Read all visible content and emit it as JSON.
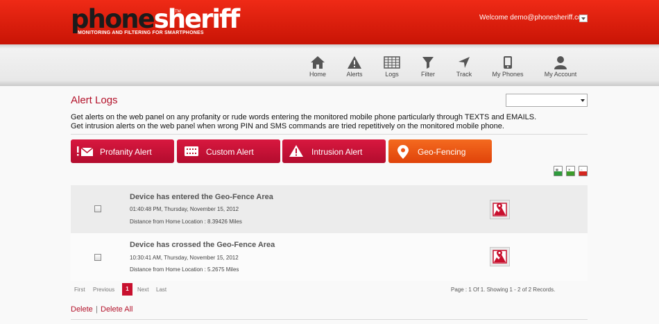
{
  "brand": {
    "part1": "phone",
    "part2": "sheriff",
    "tm": "TM",
    "tagline": "MONITORING AND FILTERING FOR SMARTPHONES"
  },
  "user": {
    "welcome": "Welcome demo@phonesheriff.com"
  },
  "nav": [
    {
      "label": "Home",
      "icon": "home-icon"
    },
    {
      "label": "Alerts",
      "icon": "alert-triangle-icon"
    },
    {
      "label": "Logs",
      "icon": "logs-grid-icon"
    },
    {
      "label": "Filter",
      "icon": "funnel-icon"
    },
    {
      "label": "Track",
      "icon": "location-arrow-icon"
    },
    {
      "label": "My Phones",
      "icon": "phone-icon"
    },
    {
      "label": "My Account",
      "icon": "user-icon"
    }
  ],
  "page": {
    "title": "Alert Logs",
    "select_value": "",
    "desc_line1": "Get alerts on the web panel on any profanity or rude words entering the monitored mobile phone particularly through TEXTS and EMAILS.",
    "desc_line2": "Get intrusion alerts on the web panel when wrong PIN and SMS commands are tried repetitively on the monitored mobile phone."
  },
  "alert_buttons": [
    {
      "label": "Profanity Alert",
      "icon": "mail-exclaim-icon",
      "active": false
    },
    {
      "label": "Custom Alert",
      "icon": "keypad-icon",
      "active": false
    },
    {
      "label": "Intrusion Alert",
      "icon": "warning-icon",
      "active": false
    },
    {
      "label": "Geo-Fencing",
      "icon": "map-pin-icon",
      "active": true
    }
  ],
  "exports": [
    {
      "name": "csv-export-icon",
      "color": "#2e9b3c"
    },
    {
      "name": "xls-export-icon",
      "color": "#3c9c2a"
    },
    {
      "name": "pdf-export-icon",
      "color": "#d4261f"
    }
  ],
  "records": [
    {
      "title": "Device has entered the Geo-Fence Area",
      "time": "01:40:48 PM, Thursday, November 15, 2012",
      "distance": "Distance from Home Location : 8.39426 Miles"
    },
    {
      "title": "Device has crossed the Geo-Fence Area",
      "time": "10:30:41 AM, Thursday, November 15, 2012",
      "distance": "Distance from Home Location : 5.2675 Miles"
    }
  ],
  "pagination": {
    "first": "First",
    "previous": "Previous",
    "current": "1",
    "next": "Next",
    "last": "Last",
    "info": "Page : 1 Of 1. Showing 1 - 2 of 2 Records."
  },
  "actions": {
    "delete": "Delete",
    "separator": "|",
    "delete_all": "Delete All"
  },
  "colors": {
    "header_red": "#d81b0b",
    "accent": "#b3122a",
    "geo_orange": "#f0561a"
  }
}
